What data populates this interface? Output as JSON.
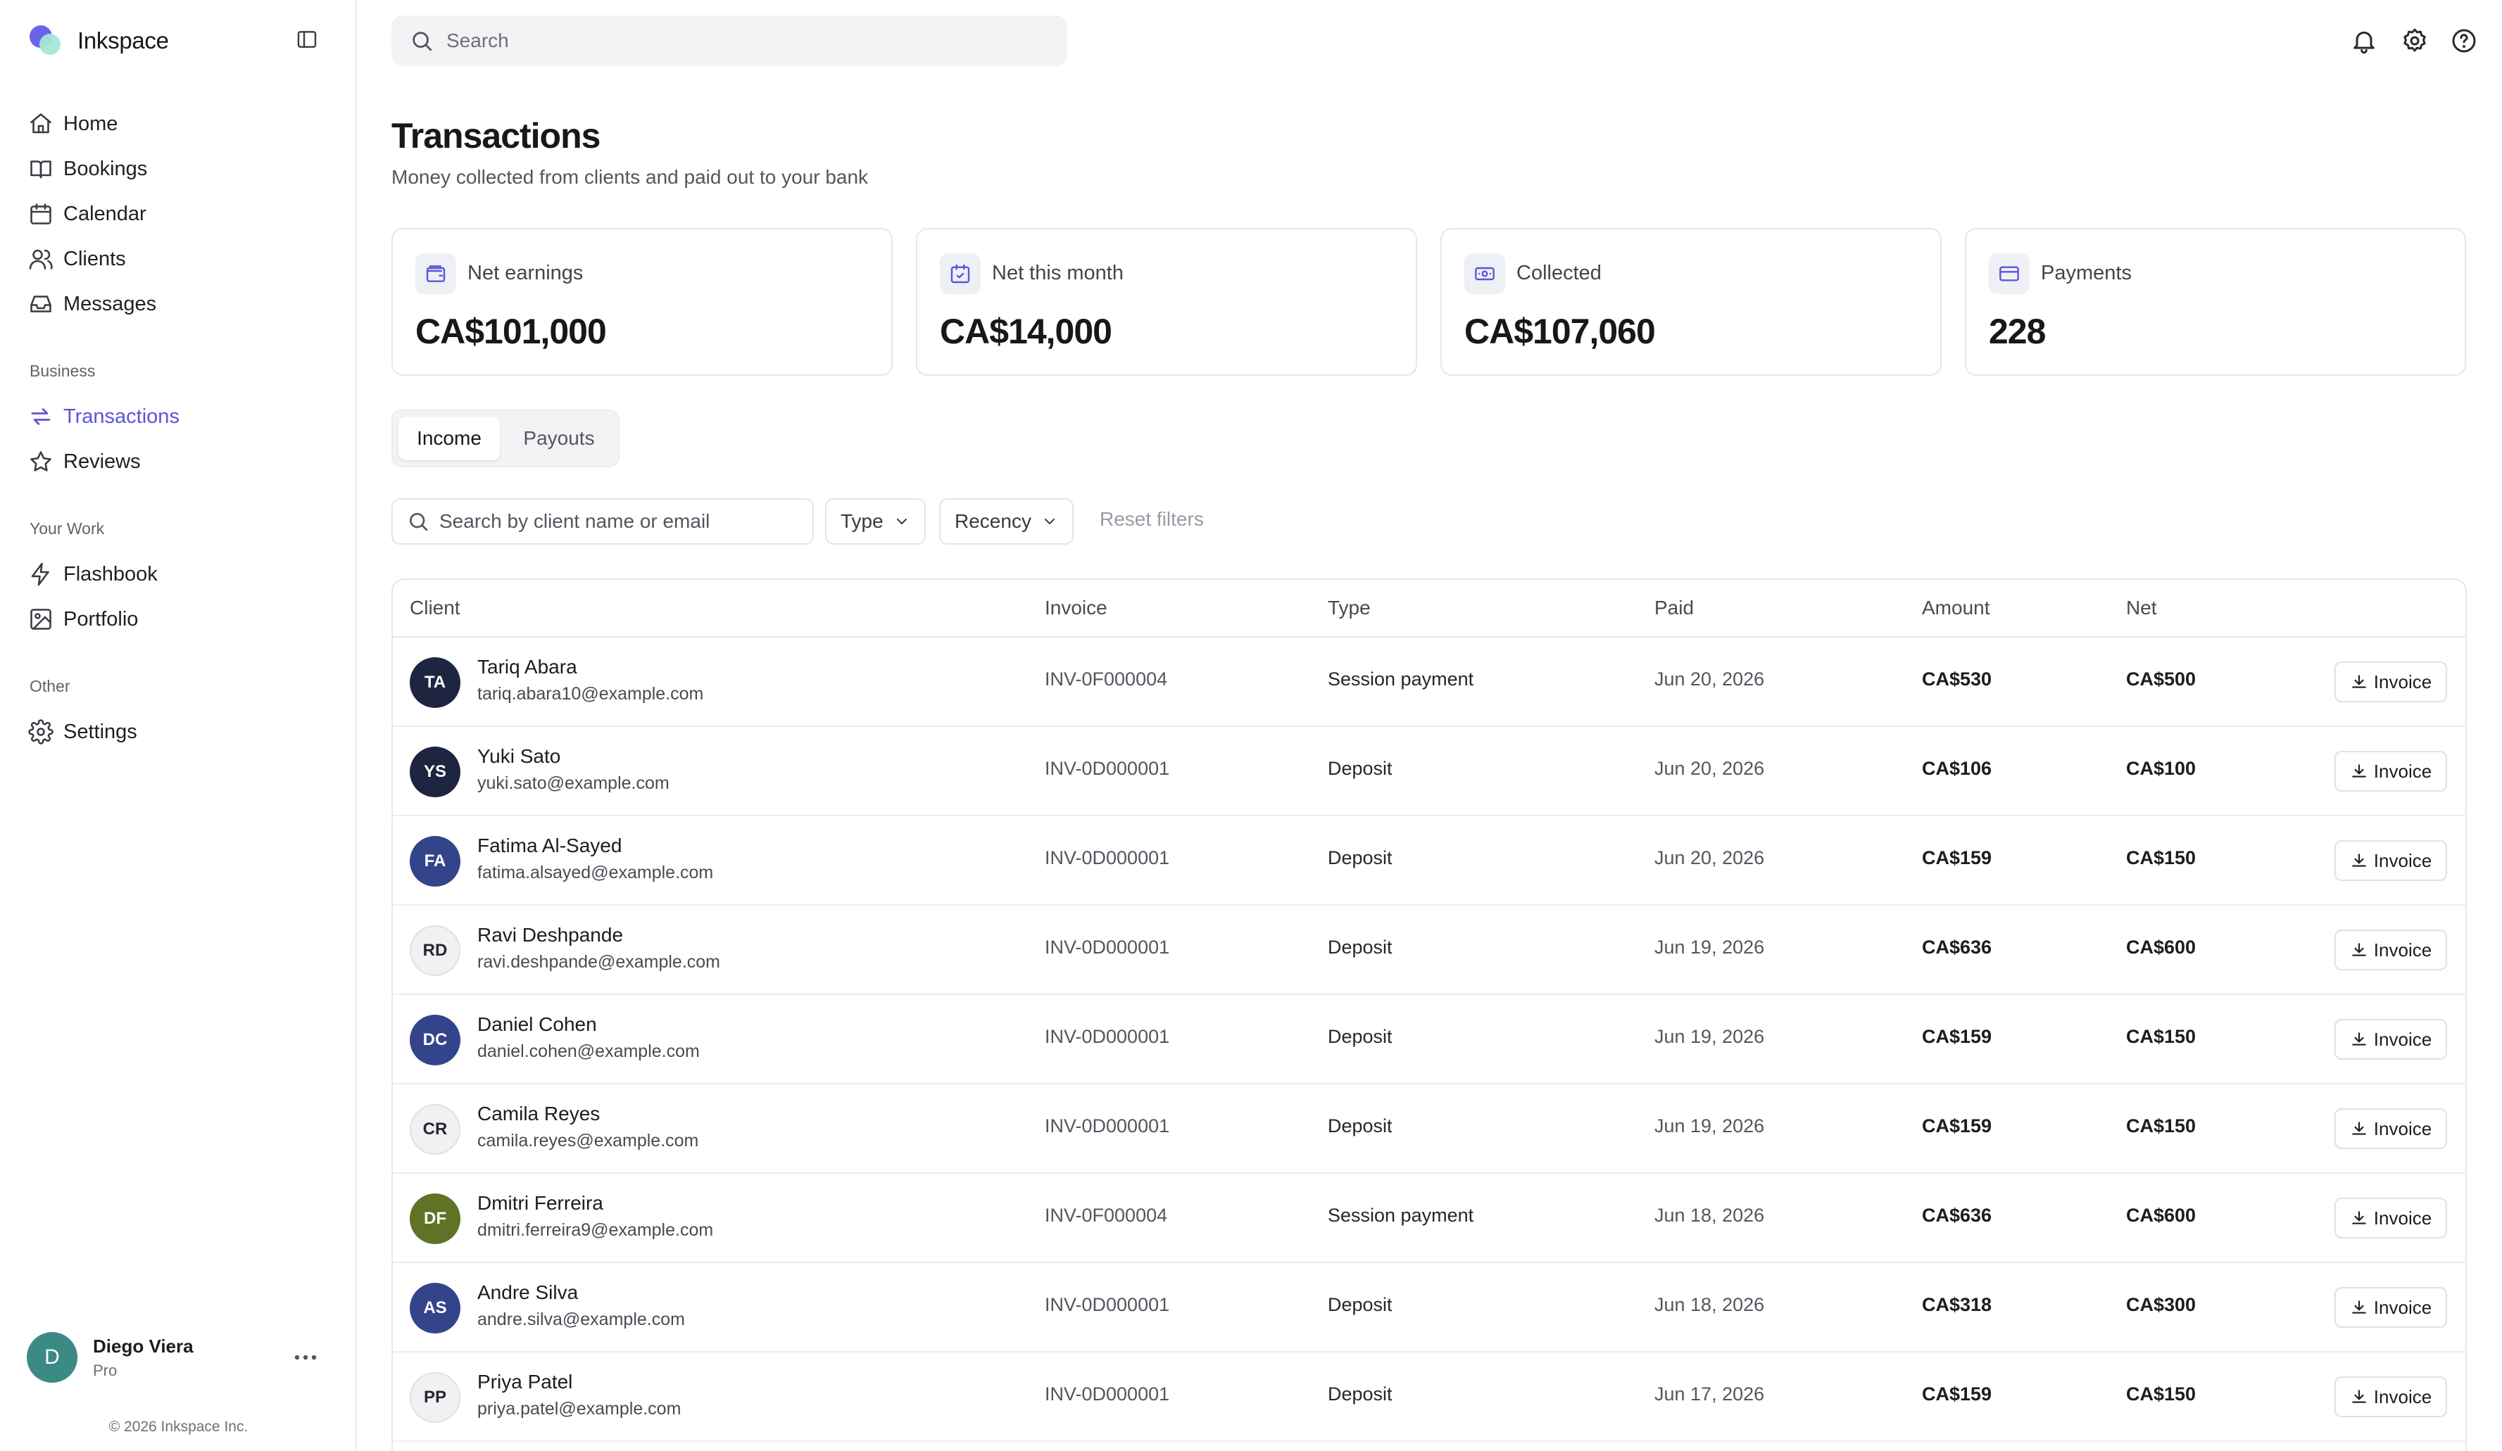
{
  "app": {
    "name": "Inkspace"
  },
  "search": {
    "placeholder": "Search"
  },
  "sidebar": {
    "main": [
      {
        "label": "Home",
        "icon": "home-icon"
      },
      {
        "label": "Bookings",
        "icon": "book-icon"
      },
      {
        "label": "Calendar",
        "icon": "calendar-icon"
      },
      {
        "label": "Clients",
        "icon": "users-icon"
      },
      {
        "label": "Messages",
        "icon": "inbox-icon"
      }
    ],
    "sections": {
      "business": "Business",
      "your_work": "Your Work",
      "other": "Other"
    },
    "business": [
      {
        "label": "Transactions",
        "icon": "transfer-icon",
        "active": true
      },
      {
        "label": "Reviews",
        "icon": "star-icon"
      }
    ],
    "your_work": [
      {
        "label": "Flashbook",
        "icon": "bolt-icon"
      },
      {
        "label": "Portfolio",
        "icon": "image-icon"
      }
    ],
    "other": [
      {
        "label": "Settings",
        "icon": "gear-icon"
      }
    ],
    "user": {
      "initial": "D",
      "name": "Diego Viera",
      "plan": "Pro"
    },
    "copyright": "© 2026 Inkspace Inc."
  },
  "header": {
    "title": "Transactions",
    "subtitle": "Money collected from clients and paid out to your bank"
  },
  "stats": [
    {
      "label": "Net earnings",
      "value": "CA$101,000",
      "icon": "wallet-icon"
    },
    {
      "label": "Net this month",
      "value": "CA$14,000",
      "icon": "calendar-check-icon"
    },
    {
      "label": "Collected",
      "value": "CA$107,060",
      "icon": "cash-icon"
    },
    {
      "label": "Payments",
      "value": "228",
      "icon": "credit-card-icon"
    }
  ],
  "tabs": {
    "income": "Income",
    "payouts": "Payouts"
  },
  "filters": {
    "search_placeholder": "Search by client name or email",
    "type": "Type",
    "recency": "Recency",
    "reset": "Reset filters"
  },
  "table": {
    "columns": {
      "client": "Client",
      "invoice": "Invoice",
      "type": "Type",
      "paid": "Paid",
      "amount": "Amount",
      "net": "Net"
    },
    "invoice_button": "Invoice",
    "rows": [
      {
        "initials": "TA",
        "name": "Tariq Abara",
        "email": "tariq.abara10@example.com",
        "invoice": "INV-0F000004",
        "type": "Session payment",
        "paid": "Jun 20, 2026",
        "amount": "CA$530",
        "net": "CA$500",
        "avatar_bg": "#1e2541",
        "avatar_fg": "#ffffff"
      },
      {
        "initials": "YS",
        "name": "Yuki Sato",
        "email": "yuki.sato@example.com",
        "invoice": "INV-0D000001",
        "type": "Deposit",
        "paid": "Jun 20, 2026",
        "amount": "CA$106",
        "net": "CA$100",
        "avatar_bg": "#1e2541",
        "avatar_fg": "#ffffff"
      },
      {
        "initials": "FA",
        "name": "Fatima Al-Sayed",
        "email": "fatima.alsayed@example.com",
        "invoice": "INV-0D000001",
        "type": "Deposit",
        "paid": "Jun 20, 2026",
        "amount": "CA$159",
        "net": "CA$150",
        "avatar_bg": "#34448a",
        "avatar_fg": "#ffffff"
      },
      {
        "initials": "RD",
        "name": "Ravi Deshpande",
        "email": "ravi.deshpande@example.com",
        "invoice": "INV-0D000001",
        "type": "Deposit",
        "paid": "Jun 19, 2026",
        "amount": "CA$636",
        "net": "CA$600",
        "avatar_bg": "#f1f1f4",
        "avatar_fg": "#26262e"
      },
      {
        "initials": "DC",
        "name": "Daniel Cohen",
        "email": "daniel.cohen@example.com",
        "invoice": "INV-0D000001",
        "type": "Deposit",
        "paid": "Jun 19, 2026",
        "amount": "CA$159",
        "net": "CA$150",
        "avatar_bg": "#34448a",
        "avatar_fg": "#ffffff"
      },
      {
        "initials": "CR",
        "name": "Camila Reyes",
        "email": "camila.reyes@example.com",
        "invoice": "INV-0D000001",
        "type": "Deposit",
        "paid": "Jun 19, 2026",
        "amount": "CA$159",
        "net": "CA$150",
        "avatar_bg": "#f1f1f4",
        "avatar_fg": "#26262e"
      },
      {
        "initials": "DF",
        "name": "Dmitri Ferreira",
        "email": "dmitri.ferreira9@example.com",
        "invoice": "INV-0F000004",
        "type": "Session payment",
        "paid": "Jun 18, 2026",
        "amount": "CA$636",
        "net": "CA$600",
        "avatar_bg": "#5f7226",
        "avatar_fg": "#ffffff"
      },
      {
        "initials": "AS",
        "name": "Andre Silva",
        "email": "andre.silva@example.com",
        "invoice": "INV-0D000001",
        "type": "Deposit",
        "paid": "Jun 18, 2026",
        "amount": "CA$318",
        "net": "CA$300",
        "avatar_bg": "#34448a",
        "avatar_fg": "#ffffff"
      },
      {
        "initials": "PP",
        "name": "Priya Patel",
        "email": "priya.patel@example.com",
        "invoice": "INV-0D000001",
        "type": "Deposit",
        "paid": "Jun 17, 2026",
        "amount": "CA$159",
        "net": "CA$150",
        "avatar_bg": "#f1f1f4",
        "avatar_fg": "#26262e"
      }
    ]
  },
  "colors": {
    "accent": "#5b55d9",
    "border": "#e7e7ea",
    "muted": "#55555f"
  }
}
